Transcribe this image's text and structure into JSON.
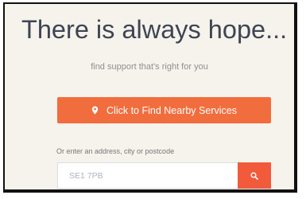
{
  "hero": {
    "title": "There is always hope...",
    "subtitle": "find support that's right for you"
  },
  "find_button": {
    "label": "Click to Find Nearby Services",
    "icon": "map-pin-icon"
  },
  "search": {
    "hint": "Or enter an address, city or postcode",
    "placeholder": "SE1 7PB",
    "value": "",
    "button_icon": "search-icon"
  },
  "colors": {
    "accent": "#f26d3d",
    "search_button": "#f15a3b",
    "title": "#3d4552",
    "card_background": "#f6f2ec"
  }
}
